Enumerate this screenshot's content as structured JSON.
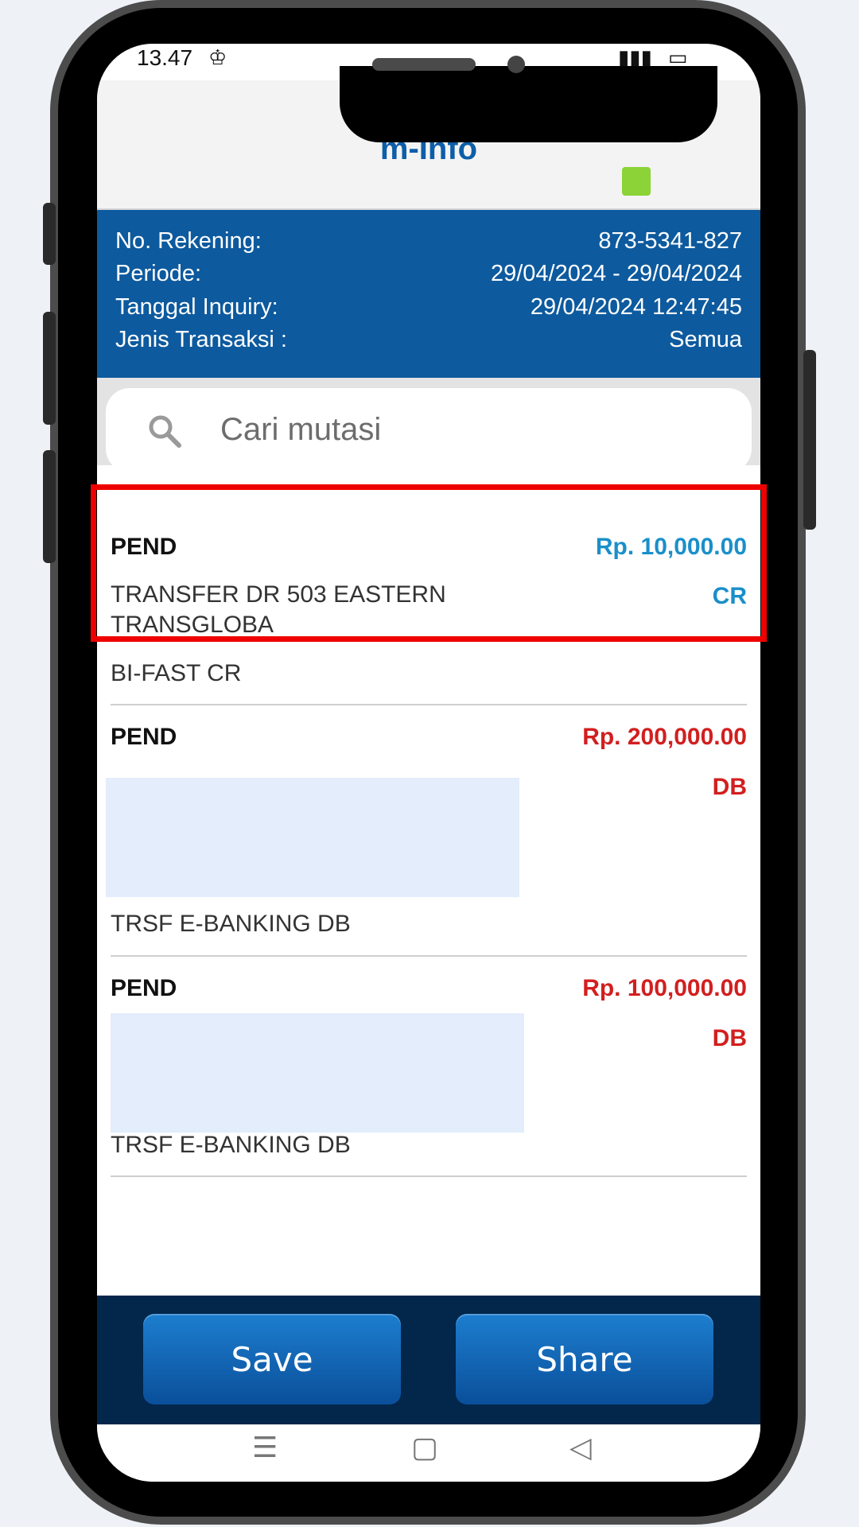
{
  "status_bar": {
    "time": "13.47",
    "signal_icon": "signal-icon",
    "battery_icon": "battery-icon"
  },
  "app_bar": {
    "title": "m-Info",
    "status_color": "#8bd336"
  },
  "account_info": {
    "rows": [
      {
        "label": "No. Rekening:",
        "value": "873-5341-827"
      },
      {
        "label": "Periode:",
        "value": "29/04/2024 - 29/04/2024"
      },
      {
        "label": "Tanggal Inquiry:",
        "value": "29/04/2024 12:47:45"
      },
      {
        "label": "Jenis Transaksi :",
        "value": "Semua"
      }
    ]
  },
  "search": {
    "placeholder": "Cari mutasi",
    "icon": "search-icon"
  },
  "transactions": [
    {
      "status": "PEND",
      "amount": "Rp. 10,000.00",
      "type": "CR",
      "description": "TRANSFER   DR 503 EASTERN TRANSGLOBA",
      "subtitle": "BI-FAST CR"
    },
    {
      "status": "PEND",
      "amount": "Rp. 200,000.00",
      "type": "DB",
      "description": "",
      "subtitle": "TRSF E-BANKING DB"
    },
    {
      "status": "PEND",
      "amount": "Rp. 100,000.00",
      "type": "DB",
      "description": "",
      "subtitle": "TRSF E-BANKING DB"
    }
  ],
  "actions": {
    "save_label": "Save",
    "share_label": "Share"
  },
  "nav_bar": {
    "menu_icon": "☰",
    "home_icon": "▢",
    "back_icon": "◁"
  },
  "colors": {
    "primary": "#0d5a9e",
    "credit": "#1a8fca",
    "debit": "#d21f1f",
    "highlight": "#ee0000"
  }
}
